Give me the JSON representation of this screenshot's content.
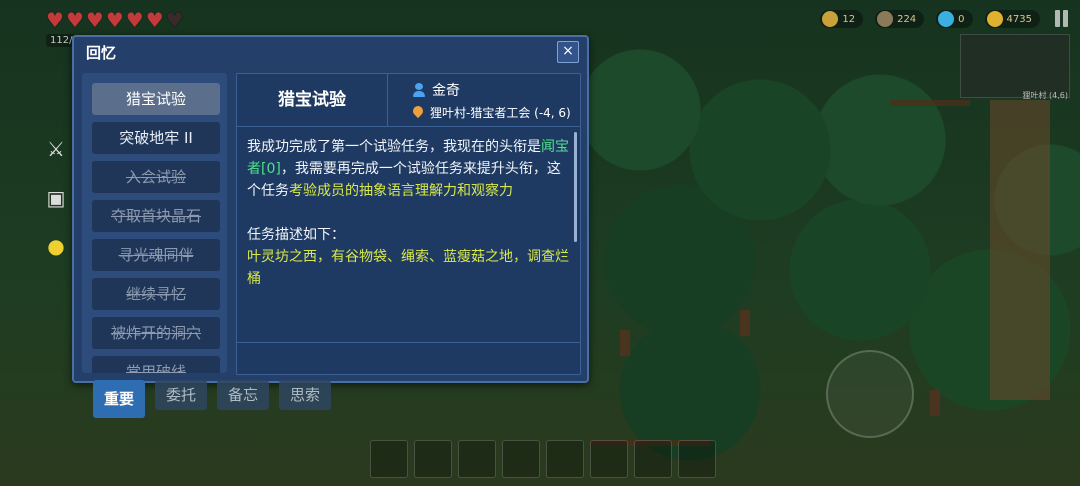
{
  "hud": {
    "hearts_full": 6,
    "hearts_total": 7,
    "level": "112/",
    "resources": [
      {
        "icon": "star-badge-icon",
        "value": "12",
        "color": "#c9a13a"
      },
      {
        "icon": "ore-icon",
        "value": "224",
        "color": "#8a7a5a"
      },
      {
        "icon": "gem-icon",
        "value": "0",
        "color": "#3ab0e0"
      },
      {
        "icon": "coin-icon",
        "value": "4735",
        "color": "#e0b030"
      }
    ],
    "minimap_label": "狸叶村 (4,6)"
  },
  "dialog": {
    "title": "回忆",
    "close_label": "×",
    "quests": [
      {
        "label": "猎宝试验",
        "state": "selected"
      },
      {
        "label": "突破地牢 II",
        "state": "active"
      },
      {
        "label": "入会试验",
        "state": "done"
      },
      {
        "label": "夺取首块晶石",
        "state": "done"
      },
      {
        "label": "寻光魂同伴",
        "state": "done"
      },
      {
        "label": "继续寻忆",
        "state": "done"
      },
      {
        "label": "被炸开的洞穴",
        "state": "done"
      },
      {
        "label": "常用破线",
        "state": "done"
      }
    ],
    "detail": {
      "title": "猎宝试验",
      "npc": "金奇",
      "location": "狸叶村-猎宝者工会 (-4, 6)",
      "p1_a": "我成功完成了第一个试验任务，我现在的头衔是",
      "p1_rank": "闻宝者[0]",
      "p1_b": "，我需要再完成一个试验任务来提升头衔，这个任务",
      "p1_goal": "考验成员的抽象语言理解力和观察力",
      "p2_label": "任务描述如下：",
      "p2_desc": "叶灵坊之西，有谷物袋、绳索、蓝瘦菇之地，调查烂桶"
    }
  },
  "tabs": [
    {
      "label": "重要",
      "active": true
    },
    {
      "label": "委托",
      "active": false
    },
    {
      "label": "备忘",
      "active": false
    },
    {
      "label": "思索",
      "active": false
    }
  ]
}
